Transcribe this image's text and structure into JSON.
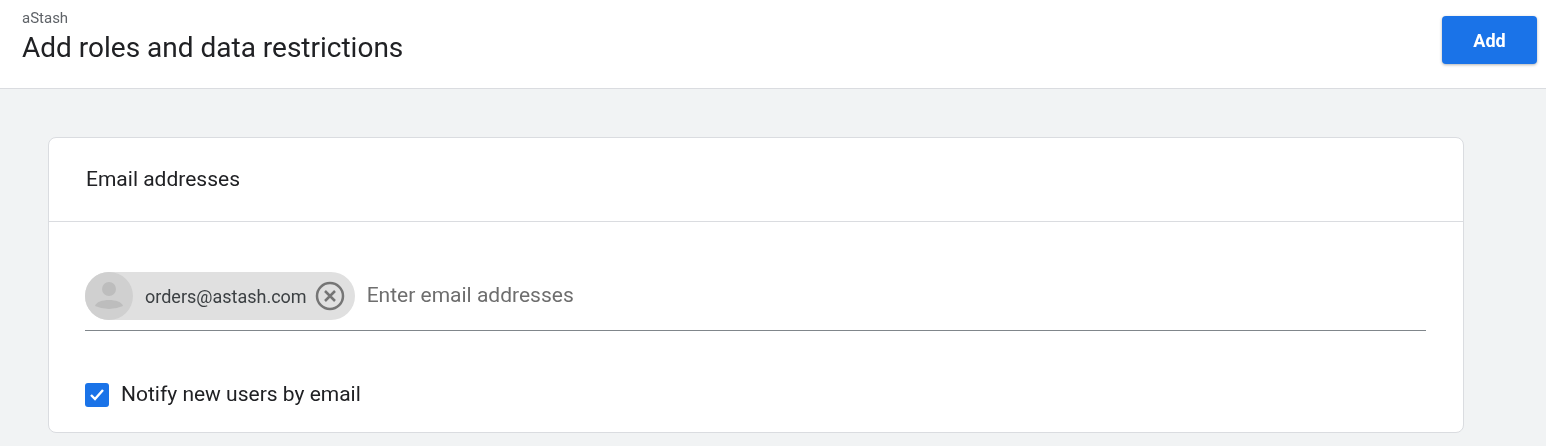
{
  "header": {
    "app_name": "aStash",
    "title": "Add roles and data restrictions",
    "action_button": "Add"
  },
  "card": {
    "title": "Email addresses",
    "recipients": [
      {
        "email": "orders@astash.com"
      }
    ],
    "input": {
      "placeholder": "Enter email addresses"
    },
    "notify": {
      "label": "Notify new users by email",
      "checked": true
    }
  }
}
